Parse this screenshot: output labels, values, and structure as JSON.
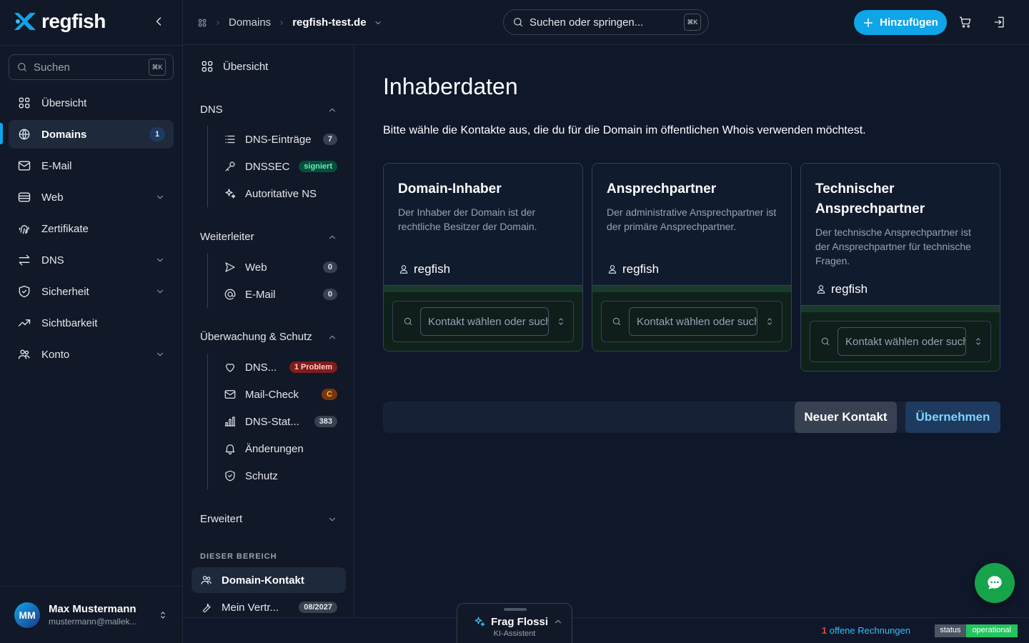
{
  "brand": {
    "name": "regfish"
  },
  "sidebar": {
    "search_label": "Suchen",
    "search_kbd": "⌘K",
    "items": [
      {
        "label": "Übersicht",
        "icon": "grid-icon"
      },
      {
        "label": "Domains",
        "icon": "globe-icon",
        "badge": "1",
        "active": true
      },
      {
        "label": "E-Mail",
        "icon": "mail-icon"
      },
      {
        "label": "Web",
        "icon": "server-icon",
        "expandable": true
      },
      {
        "label": "Zertifikate",
        "icon": "fingerprint-icon"
      },
      {
        "label": "DNS",
        "icon": "arrows-icon",
        "expandable": true
      },
      {
        "label": "Sicherheit",
        "icon": "shield-icon",
        "expandable": true
      },
      {
        "label": "Sichtbarkeit",
        "icon": "trend-icon"
      },
      {
        "label": "Konto",
        "icon": "users-icon",
        "expandable": true
      }
    ],
    "user": {
      "initials": "MM",
      "name": "Max Mustermann",
      "email": "mustermann@mallek..."
    }
  },
  "topbar": {
    "breadcrumb": {
      "parent": "Domains",
      "current": "regfish-test.de"
    },
    "search_placeholder": "Suchen oder springen...",
    "search_kbd": "⌘K",
    "add_label": "Hinzufügen"
  },
  "subnav": {
    "overview": "Übersicht",
    "dns": {
      "title": "DNS",
      "items": [
        {
          "label": "DNS-Einträge",
          "tag": "7"
        },
        {
          "label": "DNSSEC",
          "tag": "signiert"
        },
        {
          "label": "Autoritative NS",
          "tag": ""
        }
      ]
    },
    "forward": {
      "title": "Weiterleiter",
      "items": [
        {
          "label": "Web",
          "tag": "0"
        },
        {
          "label": "E-Mail",
          "tag": "0"
        }
      ]
    },
    "monitor": {
      "title": "Überwachung & Schutz",
      "items": [
        {
          "label": "DNS...",
          "tag": "1 Problem"
        },
        {
          "label": "Mail-Check",
          "tag": "C"
        },
        {
          "label": "DNS-Stat...",
          "tag": "383"
        },
        {
          "label": "Änderungen",
          "tag": ""
        },
        {
          "label": "Schutz",
          "tag": ""
        }
      ]
    },
    "advanced": "Erweitert",
    "section_label": "DIESER BEREICH",
    "current": "Domain-Kontakt",
    "contract": {
      "label": "Mein Vertr...",
      "tag": "08/2027"
    }
  },
  "main": {
    "title": "Inhaberdaten",
    "intro": "Bitte wähle die Kontakte aus, die du für die Domain im öffentlichen Whois verwenden möchtest.",
    "cards": [
      {
        "title": "Domain-Inhaber",
        "desc": "Der Inhaber der Domain ist der rechtliche Besitzer der Domain.",
        "contact": "regfish",
        "placeholder": "Kontakt wählen oder suchen"
      },
      {
        "title": "Ansprechpartner",
        "desc": "Der administrative Ansprechpartner ist der primäre Ansprechpartner.",
        "contact": "regfish",
        "placeholder": "Kontakt wählen oder suchen"
      },
      {
        "title": "Technischer Ansprechpartner",
        "desc": "Der technische Ansprechpartner ist der Ansprechpartner für technische Fragen.",
        "contact": "regfish",
        "placeholder": "Kontakt wählen oder suchen"
      }
    ],
    "btn_new": "Neuer Kontakt",
    "btn_apply": "Übernehmen"
  },
  "footer": {
    "invoice_count": "1",
    "invoice_text": " offene Rechnungen",
    "status_key": "status",
    "status_value": "operational"
  },
  "assistant": {
    "title": "Frag Flossi",
    "subtitle": "KI-Assistent"
  },
  "colors": {
    "accent": "#0ea5e9",
    "success": "#16a34a",
    "bg": "#0f172a"
  }
}
